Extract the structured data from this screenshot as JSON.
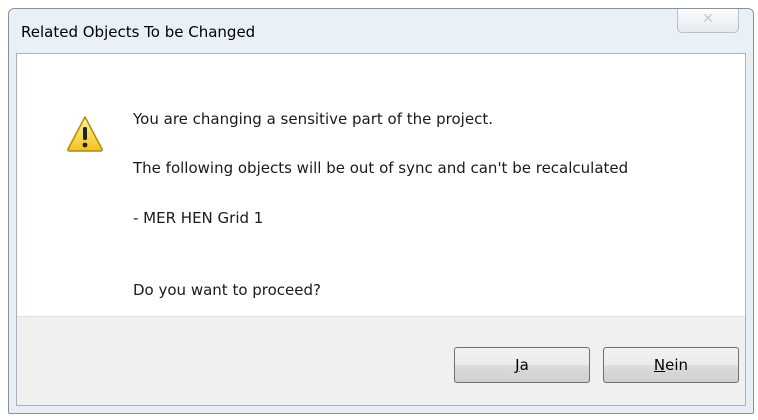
{
  "dialog": {
    "title": "Related Objects To be Changed",
    "close_icon": "close-icon"
  },
  "messages": {
    "line1": "You are changing a sensitive part of the project.",
    "line2": "The following objects will be out of sync and can't be recalculated",
    "item": "- MER HEN Grid 1",
    "question": "Do you want to proceed?"
  },
  "icon": "warning-icon",
  "buttons": {
    "yes": {
      "mnemonic": "J",
      "rest": "a"
    },
    "no": {
      "mnemonic": "N",
      "rest": "ein"
    }
  }
}
